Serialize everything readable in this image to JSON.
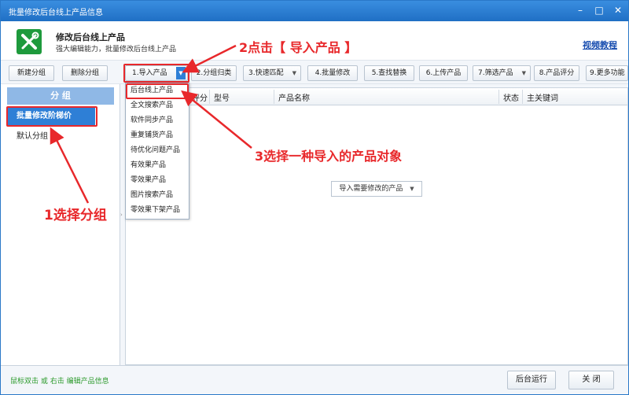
{
  "window": {
    "title": "批量修改后台线上产品信息",
    "controls": [
      "–",
      "□",
      "✕"
    ]
  },
  "header": {
    "title": "修改后台线上产品",
    "subtitle": "强大编辑能力，批量修改后台线上产品",
    "video_link": "视频教程",
    "logo_icon": "wrench-screwdriver-icon"
  },
  "sidebar": {
    "new_group": "新建分组",
    "delete_group": "删除分组",
    "group_header": "分 组",
    "groups": [
      "批量修改阶梯价",
      "默认分组"
    ]
  },
  "toolbar": {
    "buttons": [
      "1.导入产品",
      "2.分组归类",
      "3.快速匹配",
      "4.批量修改",
      "5.查找替换",
      "6.上传产品",
      "7.筛选产品",
      "8.产品评分",
      "9.更多功能"
    ]
  },
  "grid": {
    "columns": [
      "评分",
      "型号",
      "产品名称",
      "状态",
      "主关键词"
    ],
    "import_select": "导入需要修改的产品"
  },
  "dropdown": {
    "items": [
      "后台线上产品",
      "全文搜索产品",
      "软件同步产品",
      "重复铺货产品",
      "待优化问题产品",
      "有效果产品",
      "零效果产品",
      "图片搜索产品",
      "零效果下架产品"
    ]
  },
  "footer": {
    "hint": "鼠标双击 或 右击 编辑产品信息",
    "run_background": "后台运行",
    "close": "关 闭"
  },
  "annotations": {
    "step1": "1选择分组",
    "step2": "2点击【 导入产品 】",
    "step3": "3选择一种导入的产品对象"
  },
  "colors": {
    "accent": "#2e7fd6",
    "annotation": "#e8282b",
    "title_bar": "#1f6fc4",
    "hint_text": "#2b9a2b"
  }
}
